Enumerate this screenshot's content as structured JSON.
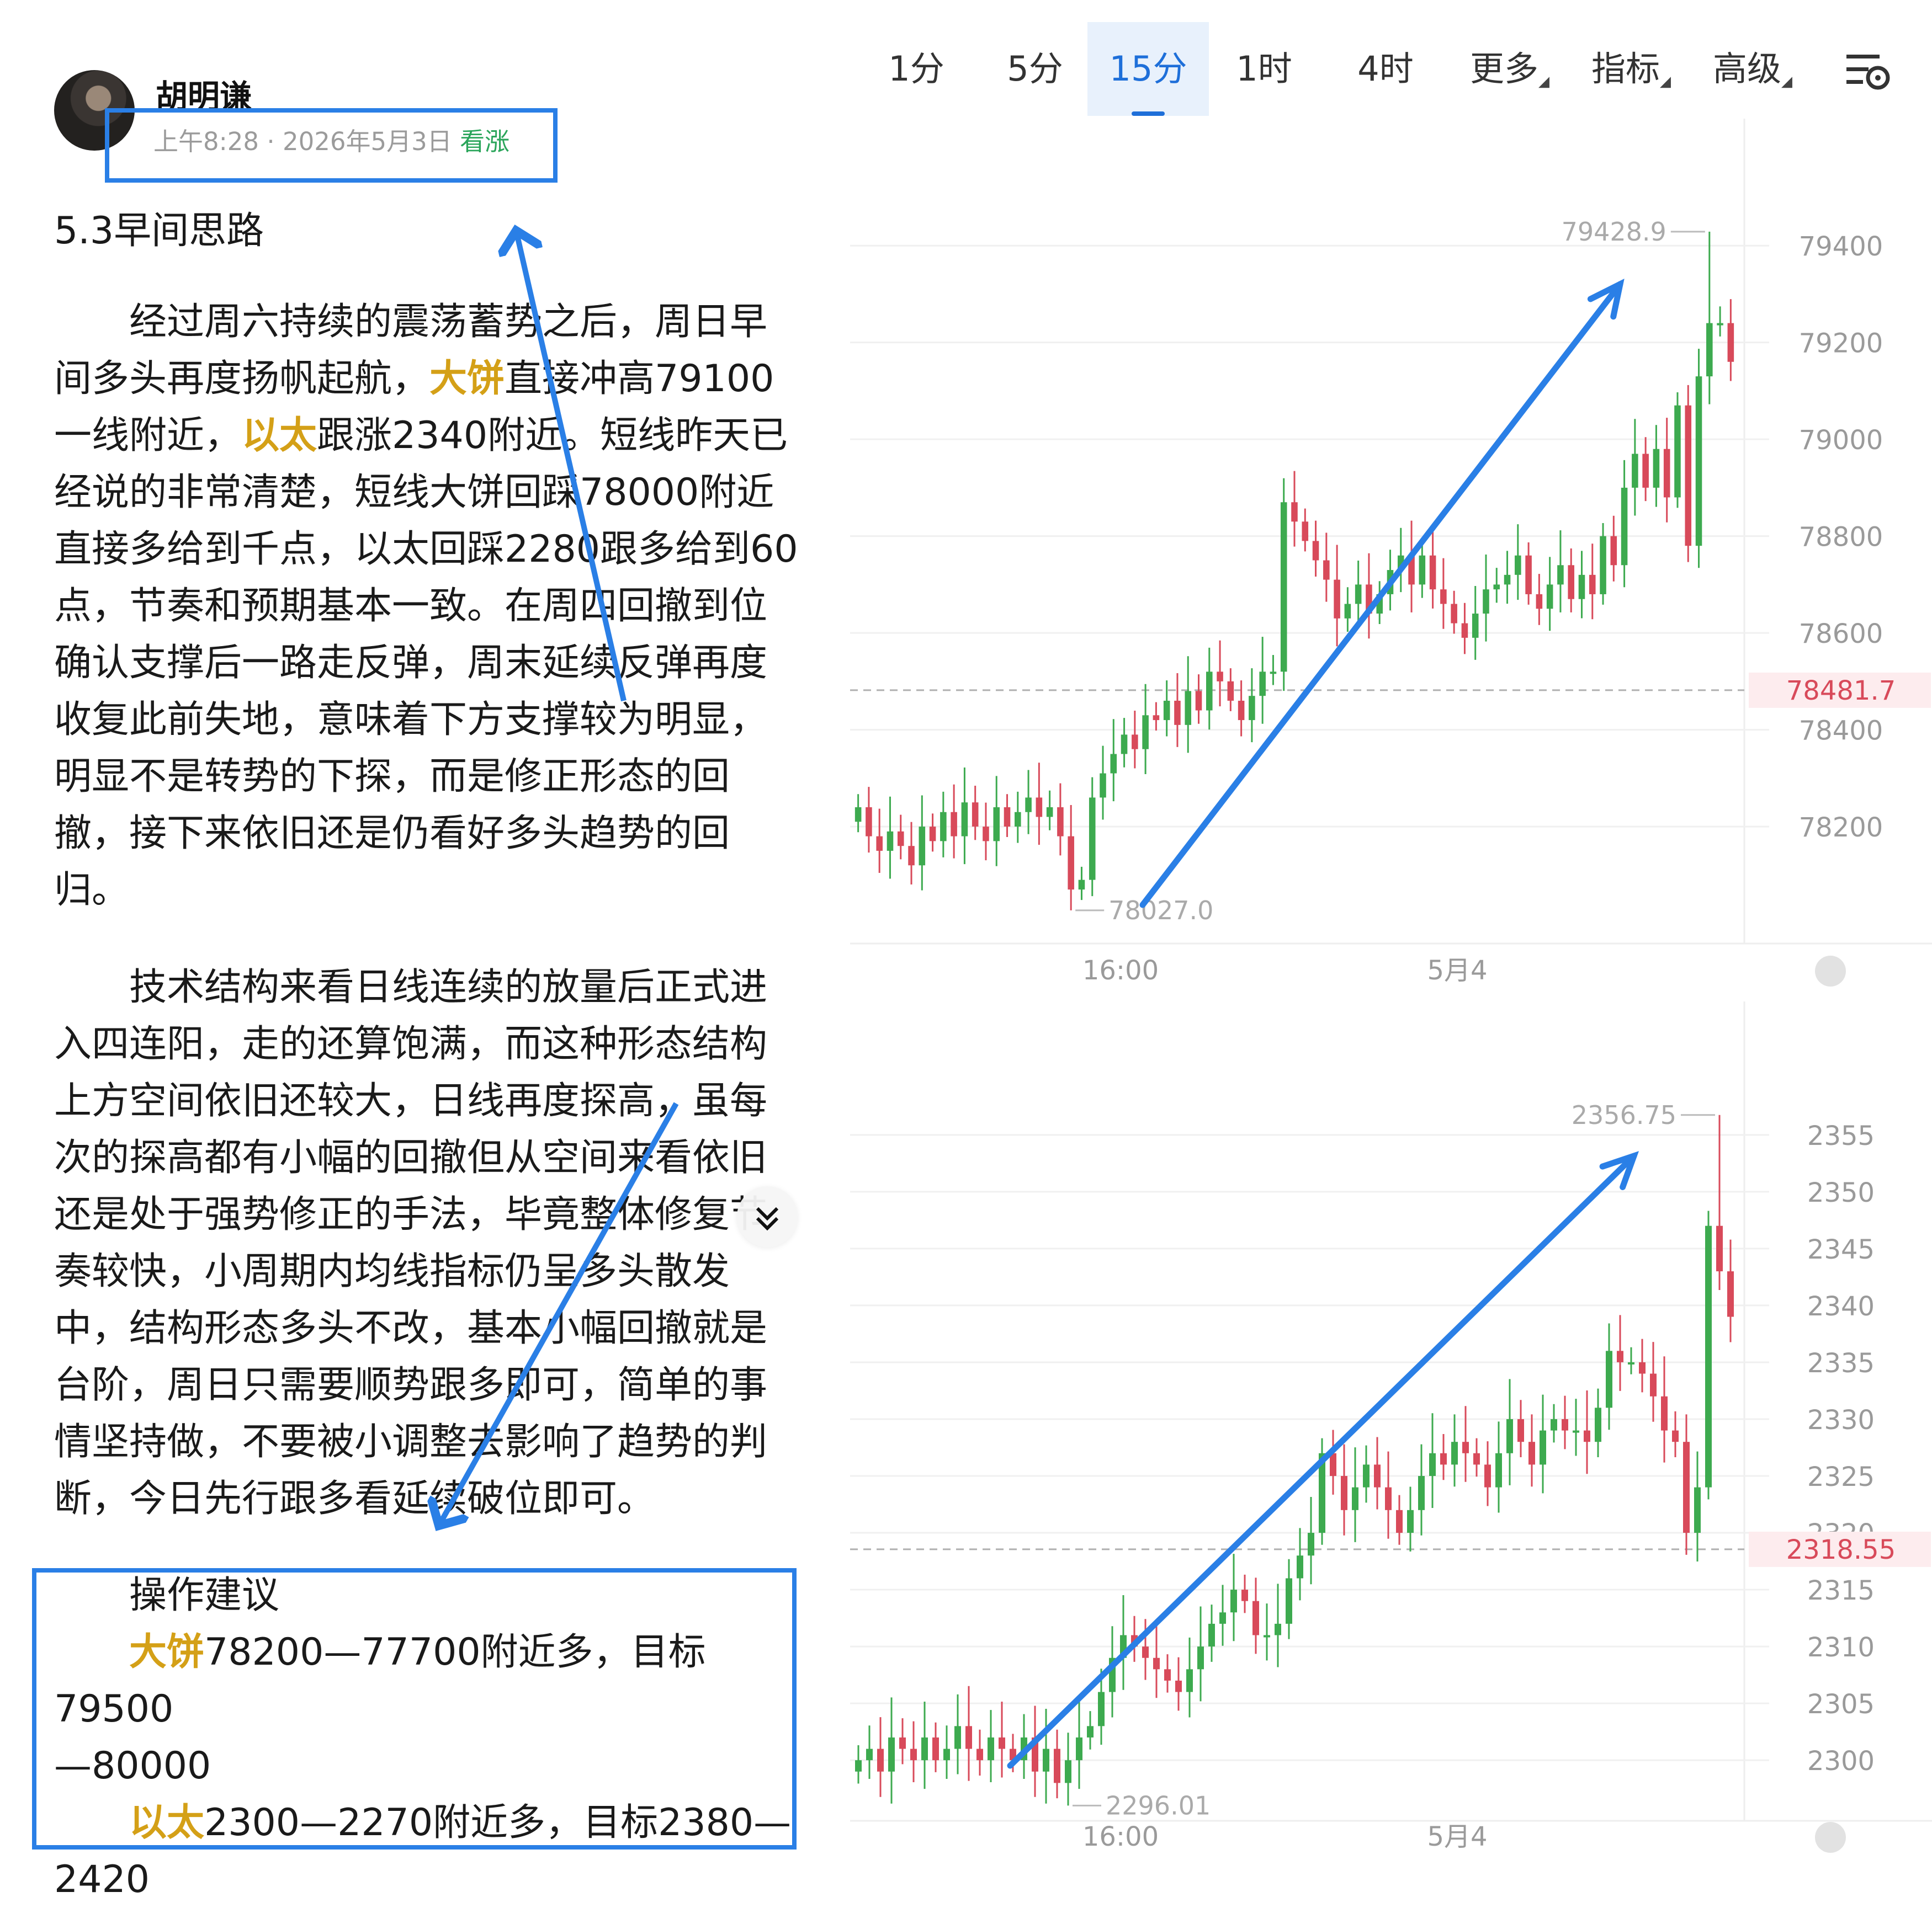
{
  "post": {
    "author": "胡明谦",
    "time": "上午8:28 · 2026年5月3日",
    "tag": "看涨",
    "title": "5.3早间思路",
    "para1": [
      "　　经过周六持续的震荡蓄势之后，周日早",
      "间多头再度扬帆起航，",
      "大饼",
      "直接冲高79100",
      "一线附近，",
      "以太",
      "跟涨2340附近。短线昨天已",
      "经说的非常清楚，短线大饼回踩78000附近",
      "直接多给到千点，以太回踩2280跟多给到60",
      "点，节奏和预期基本一致。在周四回撤到位",
      "确认支撑后一路走反弹，周末延续反弹再度",
      "收复此前失地，意味着下方支撑较为明显，",
      "明显不是转势的下探，而是修正形态的回",
      "撤，接下来依旧还是仍看好多头趋势的回",
      "归。"
    ],
    "para2": [
      "　　技术结构来看日线连续的放量后正式进",
      "入四连阳，走的还算饱满，而这种形态结构",
      "上方空间依旧还较大，日线再度探高，虽每",
      "次的探高都有小幅的回撤但从空间来看依旧",
      "还是处于强势修正的手法，毕竟整体修复节",
      "奏较快，小周期内均线指标仍呈多头散发",
      "中，结构形态多头不改，基本小幅回撤就是",
      "台阶，周日只需要顺势跟多即可，简单的事",
      "情坚持做，不要被小调整去影响了趋势的判",
      "断，今日先行跟多看延续破位即可。"
    ],
    "advice": {
      "heading": "　　操作建议",
      "btc_name": "大饼",
      "btc_text": "78200—77700附近多，目标79500",
      "btc_text2": "—80000",
      "eth_name": "以太",
      "eth_text": "2300—2270附近多，目标2380—",
      "eth_text2": "2420"
    },
    "expand_icon": "double-chevron-down-icon"
  },
  "tabs": [
    "1分",
    "5分",
    "15分",
    "1时",
    "4时",
    "更多",
    "指标",
    "高级"
  ],
  "active_tab": "15分",
  "colors": {
    "up": "#3daa4f",
    "down": "#d84a5a",
    "accent": "#1e6fd9",
    "annotation": "#2a7fe6",
    "price_line": "#d84a5a",
    "highlight": "#d4a017"
  },
  "chart_data": [
    {
      "type": "candlestick",
      "instrument": "大饼",
      "interval": "15分",
      "x_ticks": [
        "16:00",
        "5月4"
      ],
      "y_ticks": [
        "79400",
        "79200",
        "79000",
        "78800",
        "78600",
        "78400",
        "78200"
      ],
      "ylim": [
        77930,
        79480
      ],
      "high_label": "79428.9",
      "low_label": "78027.0",
      "current_price": "78481.7",
      "high": 79428.9,
      "low": 78027.0,
      "current": 78481.7,
      "closes": [
        78240,
        78180,
        78150,
        78190,
        78160,
        78120,
        78200,
        78170,
        78230,
        78180,
        78250,
        78200,
        78170,
        78240,
        78200,
        78230,
        78260,
        78220,
        78240,
        78180,
        78070,
        78090,
        78260,
        78310,
        78350,
        78390,
        78360,
        78430,
        78420,
        78460,
        78410,
        78480,
        78440,
        78520,
        78500,
        78460,
        78420,
        78470,
        78520,
        78520,
        78870,
        78830,
        78790,
        78750,
        78710,
        78630,
        78660,
        78700,
        78640,
        78680,
        78730,
        78760,
        78700,
        78760,
        78690,
        78660,
        78620,
        78590,
        78640,
        78690,
        78700,
        78720,
        78760,
        78680,
        78650,
        78700,
        78740,
        78670,
        78720,
        78680,
        78800,
        78740,
        78900,
        78970,
        78900,
        78980,
        78880,
        79070,
        78780,
        79130,
        79240,
        79240,
        79160
      ]
    },
    {
      "type": "candlestick",
      "instrument": "以太",
      "interval": "15分",
      "x_ticks": [
        "16:00",
        "5月4"
      ],
      "y_ticks": [
        "2355",
        "2350",
        "2345",
        "2340",
        "2335",
        "2330",
        "2325",
        "2320",
        "2315",
        "2310",
        "2305",
        "2300"
      ],
      "ylim": [
        2292,
        2358
      ],
      "high_label": "2356.75",
      "low_label": "2296.01",
      "current_price": "2318.55",
      "high": 2356.75,
      "low": 2296.01,
      "current": 2318.55,
      "closes": [
        2300,
        2301,
        2299,
        2302,
        2301,
        2300,
        2302,
        2300,
        2301,
        2303,
        2301,
        2300,
        2302,
        2301,
        2300,
        2302,
        2299,
        2301,
        2298,
        2300,
        2302,
        2303,
        2306,
        2309,
        2311,
        2310,
        2309,
        2308,
        2307,
        2306,
        2308,
        2310,
        2312,
        2313,
        2315,
        2314,
        2311,
        2311,
        2312,
        2316,
        2318,
        2320,
        2327,
        2325,
        2322,
        2324,
        2326,
        2324,
        2322,
        2320,
        2322,
        2325,
        2327,
        2326,
        2328,
        2327,
        2326,
        2324,
        2327,
        2330,
        2328,
        2326,
        2329,
        2330,
        2329,
        2329,
        2328,
        2331,
        2336,
        2335,
        2335,
        2334,
        2332,
        2329,
        2328,
        2320,
        2324,
        2347,
        2343,
        2339
      ]
    }
  ]
}
